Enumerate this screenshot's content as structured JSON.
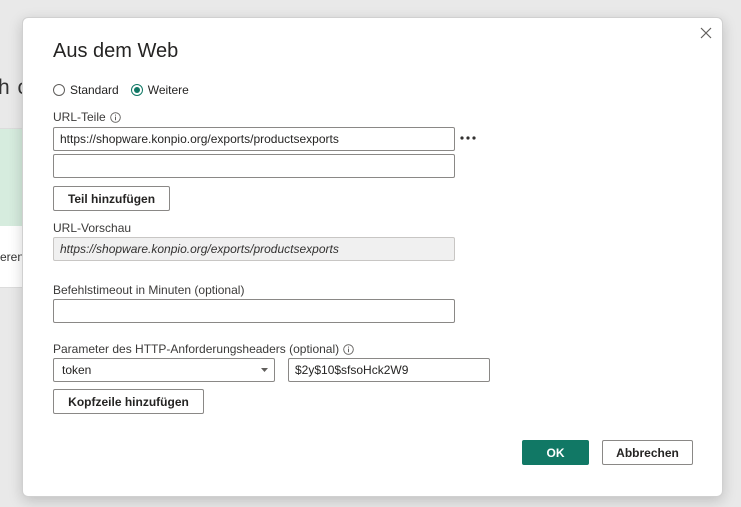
{
  "background": {
    "fragment_text": "h c",
    "fragment_small": "eren"
  },
  "dialog": {
    "title": "Aus dem Web",
    "close_icon": "close-icon",
    "mode_options": [
      {
        "label": "Standard",
        "checked": false
      },
      {
        "label": "Weitere",
        "checked": true
      }
    ],
    "url_parts_label": "URL-Teile",
    "url_parts": [
      "https://shopware.konpio.org/exports/productsexports",
      ""
    ],
    "add_part_button": "Teil hinzufügen",
    "url_preview_label": "URL-Vorschau",
    "url_preview_value": "https://shopware.konpio.org/exports/productsexports",
    "timeout_label": "Befehlstimeout in Minuten (optional)",
    "timeout_value": "",
    "headers_label": "Parameter des HTTP-Anforderungsheaders (optional)",
    "header_name": "token",
    "header_value": "$2y$10$sfsoHck2W9",
    "add_header_button": "Kopfzeile hinzufügen",
    "ok_button": "OK",
    "cancel_button": "Abbrechen"
  },
  "colors": {
    "accent": "#117865"
  }
}
